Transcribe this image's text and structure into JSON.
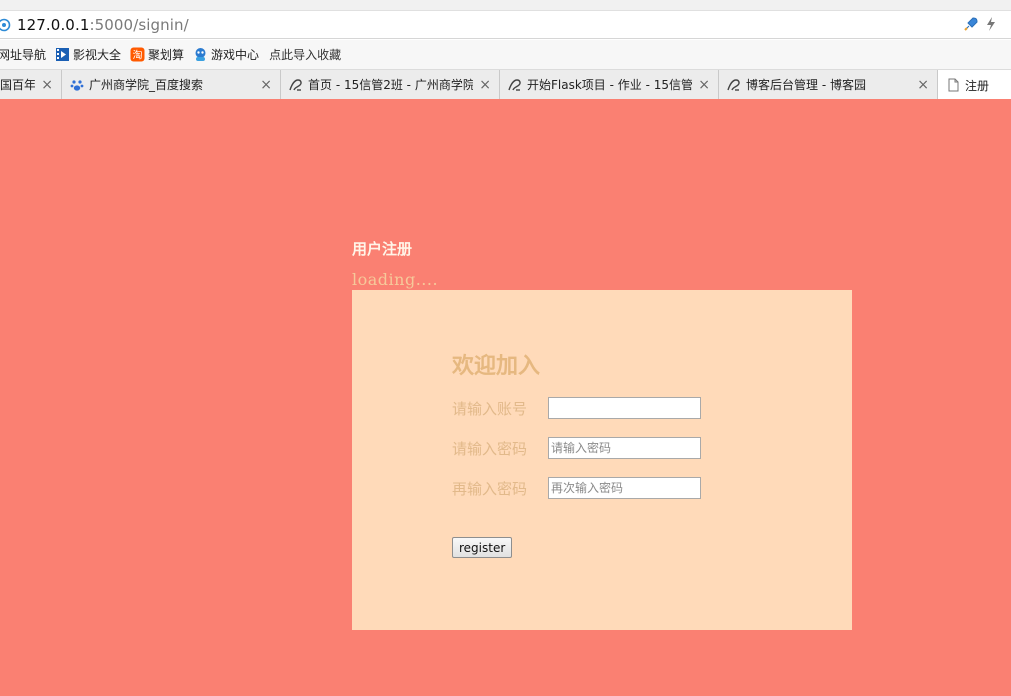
{
  "browser": {
    "address": {
      "host": "127.0.0.1",
      "path": ":5000/signin/"
    },
    "bookmarks": [
      {
        "label": "网址导航",
        "icon": "none"
      },
      {
        "label": "影视大全",
        "icon": "film-icon"
      },
      {
        "label": "聚划算",
        "icon": "taobao-icon"
      },
      {
        "label": "游戏中心",
        "icon": "game-icon"
      },
      {
        "label": "点此导入收藏",
        "icon": "none"
      }
    ],
    "tabs": [
      {
        "title": "国百年",
        "icon": "none",
        "close": "×"
      },
      {
        "title": "广州商学院_百度搜索",
        "icon": "baidu-paw-icon",
        "close": "×"
      },
      {
        "title": "首页 - 15信管2班 - 广州商学院",
        "icon": "cnblogs-icon",
        "close": "×"
      },
      {
        "title": "开始Flask项目 - 作业 - 15信管",
        "icon": "cnblogs-icon",
        "close": "×"
      },
      {
        "title": "博客后台管理 - 博客园",
        "icon": "cnblogs-icon",
        "close": "×"
      },
      {
        "title": "注册",
        "icon": "page-icon",
        "close": ""
      }
    ]
  },
  "page": {
    "heading": "用户注册",
    "loading": "loading....",
    "form": {
      "title": "欢迎加入",
      "fields": [
        {
          "label": "请输入账号",
          "placeholder": "",
          "value": ""
        },
        {
          "label": "请输入密码",
          "placeholder": "请输入密码",
          "value": ""
        },
        {
          "label": "再输入密码",
          "placeholder": "再次输入密码",
          "value": ""
        }
      ],
      "submit_label": "register"
    }
  },
  "colors": {
    "page_bg": "#fa8072",
    "card_bg": "#ffdab9",
    "label_color": "#e2b98a"
  }
}
